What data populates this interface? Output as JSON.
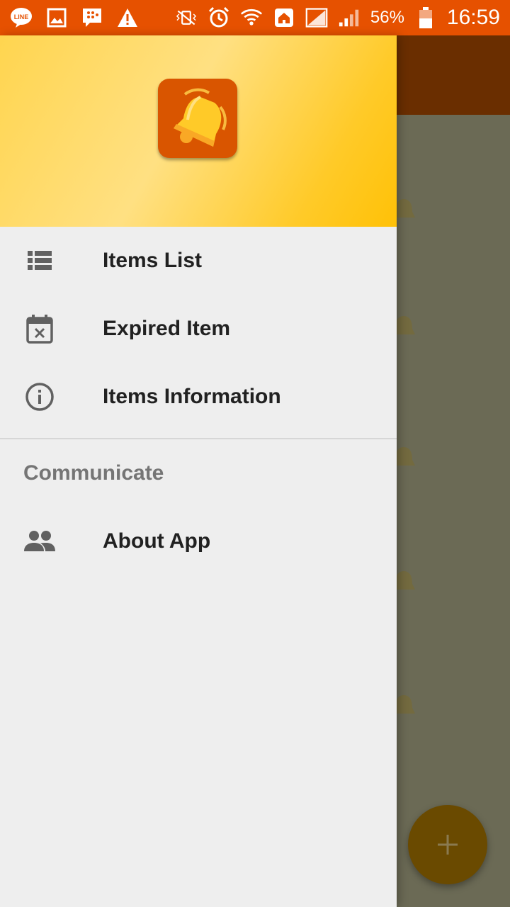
{
  "status_bar": {
    "battery": "56%",
    "time": "16:59",
    "icons": [
      "line-icon",
      "gallery-icon",
      "bbm-icon",
      "warning-icon",
      "vibrate-icon",
      "alarm-icon",
      "wifi-icon",
      "home-icon",
      "signal-icon",
      "battery-icon"
    ]
  },
  "drawer": {
    "logo_icon": "bell-icon",
    "items": [
      {
        "label": "Items List",
        "icon": "list-icon"
      },
      {
        "label": "Expired Item",
        "icon": "calendar-x-icon"
      },
      {
        "label": "Items Information",
        "icon": "info-icon"
      }
    ],
    "section_title": "Communicate",
    "section_items": [
      {
        "label": "About App",
        "icon": "people-icon"
      }
    ]
  },
  "fab": {
    "icon": "plus-icon"
  },
  "colors": {
    "status_bar": "#e65100",
    "drawer_bg": "#eeeeee",
    "header_gradient": "#ffd54f",
    "logo_bg": "#d95500",
    "scrim": "#6b6a55",
    "fab": "#6a4a00"
  }
}
